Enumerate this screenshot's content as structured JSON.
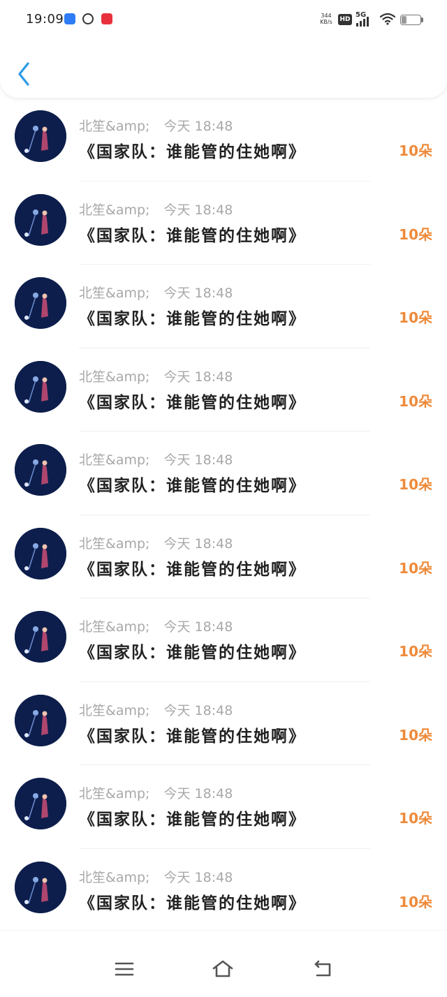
{
  "status_bar": {
    "time": "19:09",
    "net_speed_value": "344",
    "net_speed_unit": "KB/s",
    "hd_label": "HD",
    "network_label": "5G",
    "battery_level": "26",
    "battery_fraction": 0.26
  },
  "header": {
    "back_icon": "chevron-left-icon",
    "accent_color": "#2d9ae6"
  },
  "messages": [
    {
      "sender": "北笙&amp;",
      "time": "今天 18:48",
      "title": "《国家队：谁能管的住她啊》",
      "count": "10朵"
    },
    {
      "sender": "北笙&amp;",
      "time": "今天 18:48",
      "title": "《国家队：谁能管的住她啊》",
      "count": "10朵"
    },
    {
      "sender": "北笙&amp;",
      "time": "今天 18:48",
      "title": "《国家队：谁能管的住她啊》",
      "count": "10朵"
    },
    {
      "sender": "北笙&amp;",
      "time": "今天 18:48",
      "title": "《国家队：谁能管的住她啊》",
      "count": "10朵"
    },
    {
      "sender": "北笙&amp;",
      "time": "今天 18:48",
      "title": "《国家队：谁能管的住她啊》",
      "count": "10朵"
    },
    {
      "sender": "北笙&amp;",
      "time": "今天 18:48",
      "title": "《国家队：谁能管的住她啊》",
      "count": "10朵"
    },
    {
      "sender": "北笙&amp;",
      "time": "今天 18:48",
      "title": "《国家队：谁能管的住她啊》",
      "count": "10朵"
    },
    {
      "sender": "北笙&amp;",
      "time": "今天 18:48",
      "title": "《国家队：谁能管的住她啊》",
      "count": "10朵"
    },
    {
      "sender": "北笙&amp;",
      "time": "今天 18:48",
      "title": "《国家队：谁能管的住她啊》",
      "count": "10朵"
    },
    {
      "sender": "北笙&amp;",
      "time": "今天 18:48",
      "title": "《国家队：谁能管的住她啊》",
      "count": "10朵"
    }
  ],
  "colors": {
    "count": "#ee8a3a",
    "meta": "#a8a8a8",
    "title": "#222222"
  },
  "nav": {
    "menu_icon": "menu-icon",
    "home_icon": "home-icon",
    "back_icon": "back-icon"
  }
}
